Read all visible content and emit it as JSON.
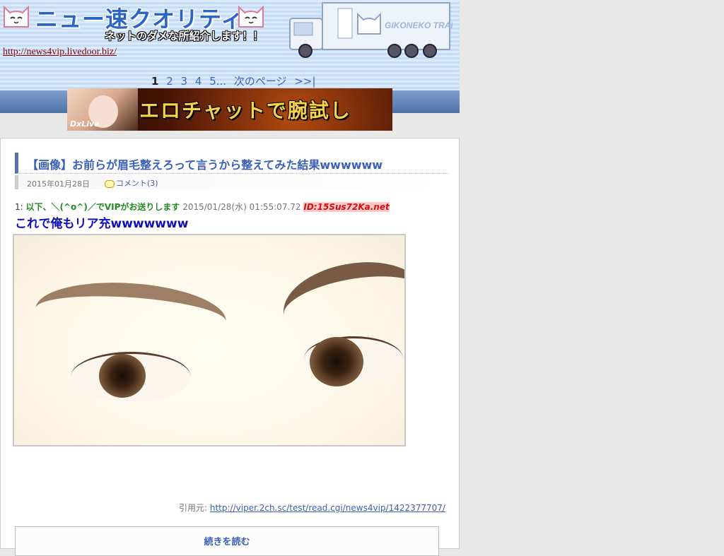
{
  "header": {
    "site_title": "ニュー速クオリティ",
    "subtitle": "ネットのダメな所紹介します！！",
    "site_url": "http://news4vip.livedoor.biz/",
    "truck_text": "GIKONEKO TRANSPORT"
  },
  "pager": {
    "pages": [
      "1",
      "2",
      "3",
      "4",
      "5"
    ],
    "current": "1",
    "ellipsis": "...",
    "next_label": "次のページ",
    "last_label": ">>|"
  },
  "banner": {
    "brand": "DxLive",
    "text": "エロチャットで腕試し"
  },
  "article": {
    "title": "【画像】お前らが眉毛整えろって言うから整えてみた結果wwwwww",
    "date": "2015年01月28日",
    "comments_label": "コメント(3)",
    "post": {
      "number": "1:",
      "name": "以下、＼(^o^)／でVIPがお送りします",
      "datetime": "2015/01/28(水) 01:55:07.72",
      "id": "ID:15Sus72Ka.net",
      "body": "これで俺もリア充wwwwwww"
    },
    "source_label": "引用元:",
    "source_url": "http://viper.2ch.sc/test/read.cgi/news4vip/1422377707/",
    "read_more_label": "続きを読む"
  },
  "colors": {
    "link": "#3a5fb8",
    "post_name": "#228b22",
    "post_body": "#1010c0",
    "post_id": "#d01010",
    "site_url": "#8b0000"
  },
  "icons": {
    "logo_left": "cat-face-icon",
    "logo_right": "cat-face-icon",
    "comment": "speech-bubble-icon"
  }
}
